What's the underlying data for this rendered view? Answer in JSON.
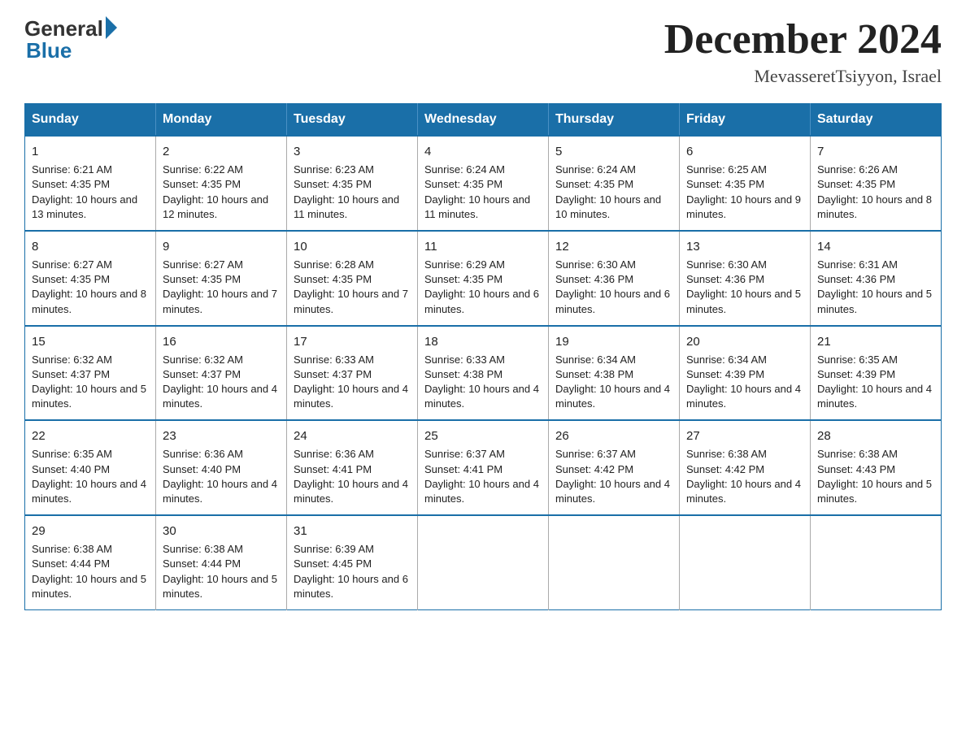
{
  "header": {
    "logo": {
      "general": "General",
      "blue": "Blue"
    },
    "title": "December 2024",
    "location": "MevasseretTsiyyon, Israel"
  },
  "calendar": {
    "days_of_week": [
      "Sunday",
      "Monday",
      "Tuesday",
      "Wednesday",
      "Thursday",
      "Friday",
      "Saturday"
    ],
    "weeks": [
      [
        {
          "day": "1",
          "sunrise": "6:21 AM",
          "sunset": "4:35 PM",
          "daylight": "10 hours and 13 minutes."
        },
        {
          "day": "2",
          "sunrise": "6:22 AM",
          "sunset": "4:35 PM",
          "daylight": "10 hours and 12 minutes."
        },
        {
          "day": "3",
          "sunrise": "6:23 AM",
          "sunset": "4:35 PM",
          "daylight": "10 hours and 11 minutes."
        },
        {
          "day": "4",
          "sunrise": "6:24 AM",
          "sunset": "4:35 PM",
          "daylight": "10 hours and 11 minutes."
        },
        {
          "day": "5",
          "sunrise": "6:24 AM",
          "sunset": "4:35 PM",
          "daylight": "10 hours and 10 minutes."
        },
        {
          "day": "6",
          "sunrise": "6:25 AM",
          "sunset": "4:35 PM",
          "daylight": "10 hours and 9 minutes."
        },
        {
          "day": "7",
          "sunrise": "6:26 AM",
          "sunset": "4:35 PM",
          "daylight": "10 hours and 8 minutes."
        }
      ],
      [
        {
          "day": "8",
          "sunrise": "6:27 AM",
          "sunset": "4:35 PM",
          "daylight": "10 hours and 8 minutes."
        },
        {
          "day": "9",
          "sunrise": "6:27 AM",
          "sunset": "4:35 PM",
          "daylight": "10 hours and 7 minutes."
        },
        {
          "day": "10",
          "sunrise": "6:28 AM",
          "sunset": "4:35 PM",
          "daylight": "10 hours and 7 minutes."
        },
        {
          "day": "11",
          "sunrise": "6:29 AM",
          "sunset": "4:35 PM",
          "daylight": "10 hours and 6 minutes."
        },
        {
          "day": "12",
          "sunrise": "6:30 AM",
          "sunset": "4:36 PM",
          "daylight": "10 hours and 6 minutes."
        },
        {
          "day": "13",
          "sunrise": "6:30 AM",
          "sunset": "4:36 PM",
          "daylight": "10 hours and 5 minutes."
        },
        {
          "day": "14",
          "sunrise": "6:31 AM",
          "sunset": "4:36 PM",
          "daylight": "10 hours and 5 minutes."
        }
      ],
      [
        {
          "day": "15",
          "sunrise": "6:32 AM",
          "sunset": "4:37 PM",
          "daylight": "10 hours and 5 minutes."
        },
        {
          "day": "16",
          "sunrise": "6:32 AM",
          "sunset": "4:37 PM",
          "daylight": "10 hours and 4 minutes."
        },
        {
          "day": "17",
          "sunrise": "6:33 AM",
          "sunset": "4:37 PM",
          "daylight": "10 hours and 4 minutes."
        },
        {
          "day": "18",
          "sunrise": "6:33 AM",
          "sunset": "4:38 PM",
          "daylight": "10 hours and 4 minutes."
        },
        {
          "day": "19",
          "sunrise": "6:34 AM",
          "sunset": "4:38 PM",
          "daylight": "10 hours and 4 minutes."
        },
        {
          "day": "20",
          "sunrise": "6:34 AM",
          "sunset": "4:39 PM",
          "daylight": "10 hours and 4 minutes."
        },
        {
          "day": "21",
          "sunrise": "6:35 AM",
          "sunset": "4:39 PM",
          "daylight": "10 hours and 4 minutes."
        }
      ],
      [
        {
          "day": "22",
          "sunrise": "6:35 AM",
          "sunset": "4:40 PM",
          "daylight": "10 hours and 4 minutes."
        },
        {
          "day": "23",
          "sunrise": "6:36 AM",
          "sunset": "4:40 PM",
          "daylight": "10 hours and 4 minutes."
        },
        {
          "day": "24",
          "sunrise": "6:36 AM",
          "sunset": "4:41 PM",
          "daylight": "10 hours and 4 minutes."
        },
        {
          "day": "25",
          "sunrise": "6:37 AM",
          "sunset": "4:41 PM",
          "daylight": "10 hours and 4 minutes."
        },
        {
          "day": "26",
          "sunrise": "6:37 AM",
          "sunset": "4:42 PM",
          "daylight": "10 hours and 4 minutes."
        },
        {
          "day": "27",
          "sunrise": "6:38 AM",
          "sunset": "4:42 PM",
          "daylight": "10 hours and 4 minutes."
        },
        {
          "day": "28",
          "sunrise": "6:38 AM",
          "sunset": "4:43 PM",
          "daylight": "10 hours and 5 minutes."
        }
      ],
      [
        {
          "day": "29",
          "sunrise": "6:38 AM",
          "sunset": "4:44 PM",
          "daylight": "10 hours and 5 minutes."
        },
        {
          "day": "30",
          "sunrise": "6:38 AM",
          "sunset": "4:44 PM",
          "daylight": "10 hours and 5 minutes."
        },
        {
          "day": "31",
          "sunrise": "6:39 AM",
          "sunset": "4:45 PM",
          "daylight": "10 hours and 6 minutes."
        },
        null,
        null,
        null,
        null
      ]
    ]
  }
}
